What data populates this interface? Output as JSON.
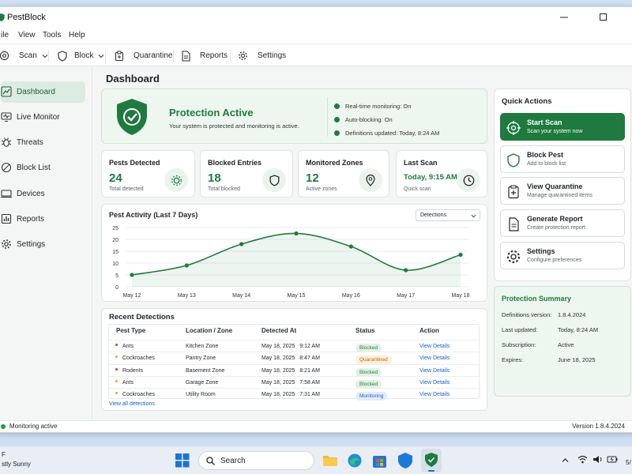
{
  "window": {
    "title": "PestBlock"
  },
  "menu": [
    "ile",
    "View",
    "Tools",
    "Help"
  ],
  "toolbar": {
    "scan": "Scan",
    "block": "Block",
    "quarantine": "Quarantine",
    "reports": "Reports",
    "settings": "Settings"
  },
  "sidebar": {
    "items": [
      {
        "label": "Dashboard",
        "icon": "dashboard-icon",
        "active": true
      },
      {
        "label": "Live Monitor",
        "icon": "monitor-icon"
      },
      {
        "label": "Threats",
        "icon": "bug-icon"
      },
      {
        "label": "Block List",
        "icon": "block-icon"
      },
      {
        "label": "Devices",
        "icon": "devices-icon"
      },
      {
        "label": "Reports",
        "icon": "reports-icon"
      },
      {
        "label": "Settings",
        "icon": "gear-icon"
      }
    ]
  },
  "page_title": "Dashboard",
  "protection": {
    "title": "Protection Active",
    "subtitle": "Your system is protected and monitoring is active.",
    "checks": [
      "Real-time monitoring: On",
      "Auto-blocking: On",
      "Definitions updated: Today, 8:24 AM"
    ]
  },
  "stats": [
    {
      "label": "Pests Detected",
      "value": "24",
      "sub": "Total detected",
      "icon": "bug-icon"
    },
    {
      "label": "Blocked Entries",
      "value": "18",
      "sub": "Total blocked",
      "icon": "shield-icon"
    },
    {
      "label": "Monitored Zones",
      "value": "12",
      "sub": "Active zones",
      "icon": "location-pin-icon"
    },
    {
      "label": "Last Scan",
      "value": "Today, 9:15 AM",
      "sub": "Quick scan",
      "icon": "clock-icon"
    }
  ],
  "chart": {
    "title": "Pest Activity (Last 7 Days)",
    "dropdown": "Detections"
  },
  "chart_data": {
    "type": "area",
    "categories": [
      "May 12",
      "May 13",
      "May 14",
      "May 15",
      "May 16",
      "May 17",
      "May 18"
    ],
    "values": [
      5,
      9,
      18,
      22.5,
      17,
      7,
      13.5
    ],
    "ylim": [
      0,
      25
    ],
    "yticks": [
      0,
      5,
      10,
      15,
      20,
      25
    ],
    "grid": true,
    "title": "Pest Activity (Last 7 Days)",
    "color": "#1f7a3f"
  },
  "detections": {
    "title": "Recent Detections",
    "headers": [
      "Pest Type",
      "Location / Zone",
      "Detected At",
      "Status",
      "Action"
    ],
    "rows": [
      {
        "pest": "Ants",
        "zone": "Kitchen Zone",
        "time": "May 18, 2025   9:12 AM",
        "status": "Blocked",
        "kind": "blocked",
        "dot": "#d23b2f",
        "action": "View Details"
      },
      {
        "pest": "Cockroaches",
        "zone": "Pantry Zone",
        "time": "May 18, 2025   8:47 AM",
        "status": "Quarantined",
        "kind": "quarantined",
        "dot": "#f0a020",
        "action": "View Details"
      },
      {
        "pest": "Rodents",
        "zone": "Basement Zone",
        "time": "May 18, 2025   8:21 AM",
        "status": "Blocked",
        "kind": "blocked",
        "dot": "#d23b2f",
        "action": "View Details"
      },
      {
        "pest": "Ants",
        "zone": "Garage Zone",
        "time": "May 18, 2025   7:58 AM",
        "status": "Blocked",
        "kind": "blocked",
        "dot": "#f0a020",
        "action": "View Details"
      },
      {
        "pest": "Cockroaches",
        "zone": "Utility Room",
        "time": "May 18, 2025   7:31 AM",
        "status": "Monitoring",
        "kind": "monitoring",
        "dot": "#f0a020",
        "action": "View Details"
      }
    ],
    "view_all": "View all detections"
  },
  "quick_actions": {
    "title": "Quick Actions",
    "items": [
      {
        "title": "Start Scan",
        "sub": "Scan your system now",
        "icon": "target-icon",
        "primary": true
      },
      {
        "title": "Block Pest",
        "sub": "Add to block list",
        "icon": "shield-icon"
      },
      {
        "title": "View Quarantine",
        "sub": "Manage quarantined items",
        "icon": "quarantine-icon"
      },
      {
        "title": "Generate Report",
        "sub": "Create protection report",
        "icon": "report-icon"
      },
      {
        "title": "Settings",
        "sub": "Configure preferences",
        "icon": "gear-icon"
      }
    ]
  },
  "summary": {
    "title": "Protection Summary",
    "rows": [
      {
        "k": "Definitions version:",
        "v": "1.8.4.2024"
      },
      {
        "k": "Last updated:",
        "v": "Today, 8:24 AM"
      },
      {
        "k": "Subscription:",
        "v": "Active"
      },
      {
        "k": "Expires:",
        "v": "June 18, 2025"
      }
    ]
  },
  "statusbar": {
    "left": "Monitoring active",
    "right": "Version 1.8.4.2024"
  },
  "taskbar": {
    "weather_temp": "F",
    "weather": "stly Sunny",
    "search": "Search",
    "clock": "5/"
  }
}
